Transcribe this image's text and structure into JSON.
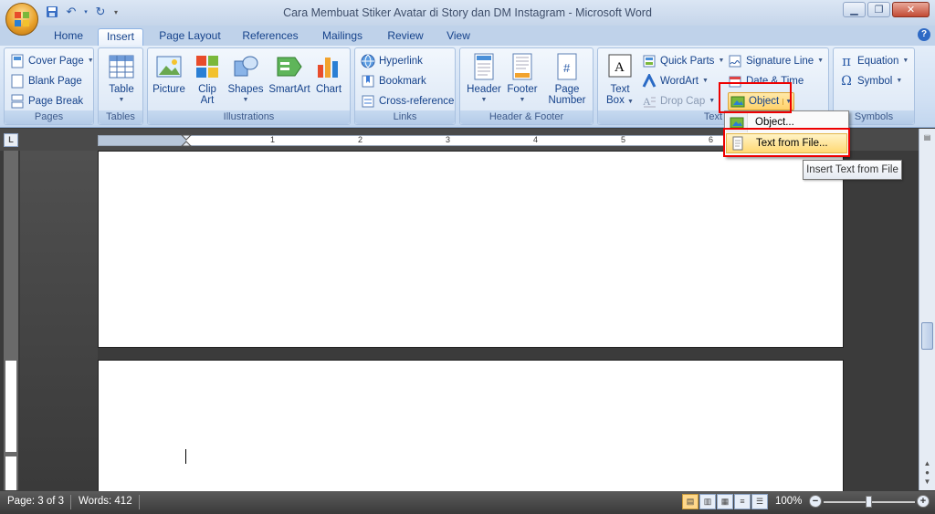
{
  "window": {
    "title": "Cara Membuat Stiker Avatar di Story dan DM Instagram - Microsoft Word"
  },
  "tabs": [
    {
      "label": "Home"
    },
    {
      "label": "Insert"
    },
    {
      "label": "Page Layout"
    },
    {
      "label": "References"
    },
    {
      "label": "Mailings"
    },
    {
      "label": "Review"
    },
    {
      "label": "View"
    }
  ],
  "active_tab": "Insert",
  "groups": {
    "pages": {
      "label": "Pages",
      "cover_page": "Cover Page",
      "blank_page": "Blank Page",
      "page_break": "Page Break"
    },
    "tables": {
      "label": "Tables",
      "table": "Table"
    },
    "illustrations": {
      "label": "Illustrations",
      "picture": "Picture",
      "clip_art_1": "Clip",
      "clip_art_2": "Art",
      "shapes": "Shapes",
      "smartart": "SmartArt",
      "chart": "Chart"
    },
    "links": {
      "label": "Links",
      "hyperlink": "Hyperlink",
      "bookmark": "Bookmark",
      "cross_reference": "Cross-reference"
    },
    "header_footer": {
      "label": "Header & Footer",
      "header": "Header",
      "footer": "Footer",
      "page_number_1": "Page",
      "page_number_2": "Number"
    },
    "text": {
      "label": "Text",
      "text_box_1": "Text",
      "text_box_2": "Box",
      "quick_parts": "Quick Parts",
      "wordart": "WordArt",
      "drop_cap": "Drop Cap",
      "signature_line": "Signature Line",
      "date_time": "Date & Time",
      "object": "Object"
    },
    "symbols": {
      "label": "Symbols",
      "equation": "Equation",
      "symbol": "Symbol"
    }
  },
  "object_menu": {
    "items": [
      {
        "label": "Object..."
      },
      {
        "label": "Text from File..."
      }
    ]
  },
  "tooltip": "Insert Text from File",
  "ruler": {
    "numbers": [
      "1",
      "2",
      "3",
      "4",
      "5",
      "6"
    ]
  },
  "ruler_selector": "L",
  "status": {
    "page": "Page: 3 of 3",
    "words": "Words: 412",
    "zoom": "100%"
  },
  "accent": {
    "ribbon": "#dbe6f4",
    "highlight": "#ffd974",
    "red_box": "#e00000"
  }
}
